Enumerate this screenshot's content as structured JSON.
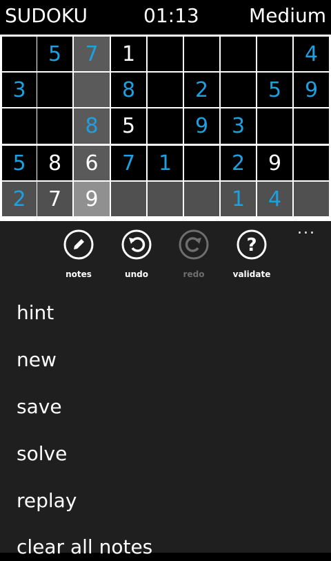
{
  "header": {
    "title": "SUDOKU",
    "timer": "01:13",
    "difficulty": "Medium"
  },
  "board": {
    "rows": [
      [
        "",
        "5",
        "7",
        "1",
        "",
        "",
        "",
        "",
        "4"
      ],
      [
        "3",
        "",
        "",
        "8",
        "",
        "2",
        "",
        "5",
        "9"
      ],
      [
        "",
        "",
        "8",
        "5",
        "",
        "9",
        "3",
        "",
        ""
      ],
      [
        "5",
        "8",
        "6",
        "7",
        "1",
        "",
        "2",
        "9",
        ""
      ],
      [
        "2",
        "7",
        "9",
        "",
        "",
        "",
        "1",
        "4",
        ""
      ]
    ],
    "cell_colors": [
      [
        "k",
        "k",
        "h",
        "k",
        "k",
        "k",
        "k",
        "k",
        "k"
      ],
      [
        "k",
        "k",
        "h",
        "k",
        "k",
        "k",
        "k",
        "k",
        "k"
      ],
      [
        "k",
        "k",
        "h",
        "k",
        "k",
        "k",
        "k",
        "k",
        "k"
      ],
      [
        "k",
        "k",
        "h",
        "k",
        "k",
        "k",
        "k",
        "k",
        "k"
      ],
      [
        "g",
        "g",
        "s",
        "g",
        "g",
        "g",
        "g",
        "g",
        "g"
      ]
    ],
    "digit_types": [
      [
        "",
        "u",
        "u",
        "f",
        "",
        "",
        "",
        "",
        "u"
      ],
      [
        "u",
        "",
        "",
        "u",
        "",
        "u",
        "",
        "u",
        "u"
      ],
      [
        "",
        "",
        "u",
        "f",
        "",
        "u",
        "u",
        "",
        ""
      ],
      [
        "u",
        "f",
        "f",
        "u",
        "u",
        "",
        "u",
        "f",
        ""
      ],
      [
        "u",
        "f",
        "f",
        "",
        "",
        "",
        "u",
        "u",
        ""
      ]
    ],
    "colors": {
      "fixed_digit": "#ffffff",
      "user_digit": "#1ba1e2",
      "cell_black": "#000000",
      "highlight_column": "#5a5a5a",
      "highlight_row": "#505050",
      "selected_cell": "#909090",
      "grid_line": "#ffffff"
    }
  },
  "appbar": {
    "buttons": [
      {
        "label": "notes",
        "icon": "pencil-icon",
        "enabled": true
      },
      {
        "label": "undo",
        "icon": "undo-icon",
        "enabled": true
      },
      {
        "label": "redo",
        "icon": "redo-icon",
        "enabled": false
      },
      {
        "label": "validate",
        "icon": "question-icon",
        "enabled": true
      }
    ],
    "more": "...",
    "menu": [
      "hint",
      "new",
      "save",
      "solve",
      "replay",
      "clear all notes"
    ]
  }
}
